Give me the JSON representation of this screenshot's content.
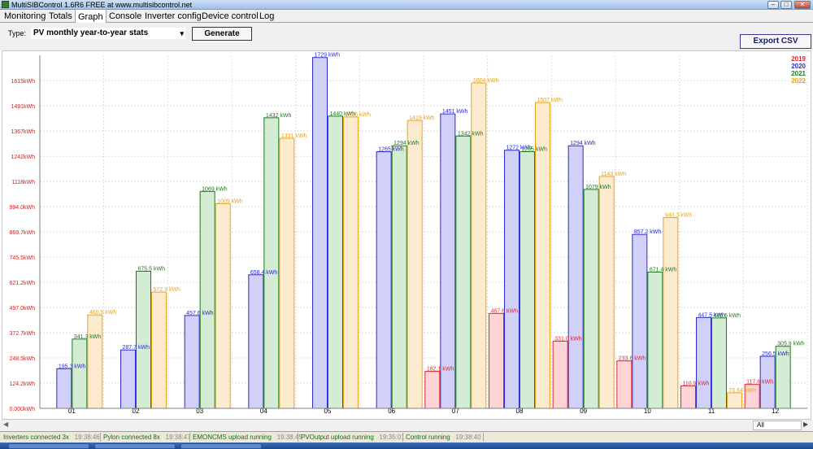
{
  "window": {
    "title": "MultiSIBControl 1.6R6 FREE at www.multisibcontrol.net",
    "icon": "app-icon"
  },
  "tabs": [
    {
      "label": "Monitoring",
      "active": false
    },
    {
      "label": "Totals",
      "active": false
    },
    {
      "label": "Graph",
      "active": true
    },
    {
      "label": "Console",
      "active": false
    },
    {
      "label": "Inverter config",
      "active": false
    },
    {
      "label": "Device control",
      "active": false
    },
    {
      "label": "Log",
      "active": false
    }
  ],
  "toolbar": {
    "type_label": "Type:",
    "type_value": "PV monthly year-to-year stats",
    "generate_label": "Generate",
    "export_label": "Export CSV"
  },
  "range": {
    "selected": "All"
  },
  "status": [
    {
      "text": "Inverters connected 3x",
      "time": "19:38:46"
    },
    {
      "text": "Pylon connected 8x",
      "time": "19:38:47"
    },
    {
      "text": "EMONCMS upload running",
      "time": "19:38:45"
    },
    {
      "text": "PVOutput upload running",
      "time": "19:35:01"
    },
    {
      "text": "Control running",
      "time": "19:38:40"
    }
  ],
  "chart_data": {
    "type": "bar",
    "categories": [
      "01",
      "02",
      "03",
      "04",
      "05",
      "06",
      "07",
      "08",
      "09",
      "10",
      "11",
      "12"
    ],
    "y_ticks": [
      "0.000kWh",
      "124.2kWh",
      "248.5kWh",
      "372.7kWh",
      "497.0kWh",
      "621.2kWh",
      "745.5kWh",
      "869.7kWh",
      "994.0kWh",
      "1118kWh",
      "1242kWh",
      "1367kWh",
      "1491kWh",
      "1615kWh"
    ],
    "ylim": [
      0,
      1740
    ],
    "grid": true,
    "legend_position": "top-right",
    "series": [
      {
        "name": "2019",
        "color": "#e0242f",
        "fill": "#ffd4d6",
        "values": [
          null,
          null,
          null,
          null,
          null,
          null,
          182.1,
          467.6,
          331.0,
          233.8,
          110.9,
          117.6
        ],
        "labels": [
          "",
          "",
          "",
          "",
          "",
          "",
          "182.1 kWh",
          "467.6 kWh",
          "331.0 kWh",
          "233.8 kWh",
          "110.9 kWh",
          "117.6 kWh"
        ]
      },
      {
        "name": "2020",
        "color": "#2a2ad0",
        "fill": "#d0d0f8",
        "values": [
          195.3,
          287.7,
          457.6,
          658.4,
          1729,
          1265,
          1451,
          1272,
          1294,
          857.2,
          447.5,
          256.5
        ],
        "labels": [
          "195.3 kWh",
          "287.7 kWh",
          "457.6 kWh",
          "658.4 kWh",
          "1729 kWh",
          "1265 kWh",
          "1451 kWh",
          "1272 kWh",
          "1294 kWh",
          "857.2 kWh",
          "447.5 kWh",
          "256.5 kWh"
        ]
      },
      {
        "name": "2021",
        "color": "#1d7a1d",
        "fill": "#d4ecd4",
        "values": [
          341.3,
          675.5,
          1069,
          1432,
          1440,
          1294,
          1342,
          1265,
          1079,
          671.4,
          445.6,
          305.9
        ],
        "labels": [
          "341.3 kWh",
          "675.5 kWh",
          "1069 kWh",
          "1432 kWh",
          "1440 kWh",
          "1294 kWh",
          "1342 kWh",
          "1265 kWh",
          "1079 kWh",
          "671.4 kWh",
          "445.6 kWh",
          "305.9 kWh"
        ]
      },
      {
        "name": "2022",
        "color": "#e8a21c",
        "fill": "#fdebd0",
        "values": [
          460.5,
          572.9,
          1009,
          1331,
          1436,
          1419,
          1604,
          1507,
          1143,
          940.3,
          76.64,
          null
        ],
        "labels": [
          "460.5 kWh",
          "572.9 kWh",
          "1009 kWh",
          "1331 kWh",
          "1436 kWh",
          "1419 kWh",
          "1604 kWh",
          "1507 kWh",
          "1143 kWh",
          "940.3 kWh",
          "76.64 kWh",
          ""
        ]
      }
    ]
  }
}
